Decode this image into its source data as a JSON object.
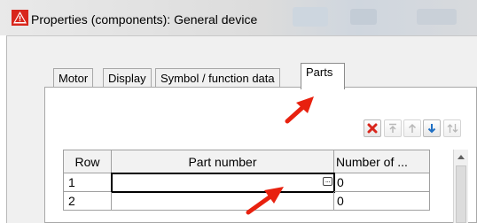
{
  "window": {
    "title": "Properties (components): General device"
  },
  "tabs": [
    {
      "label": "Motor",
      "active": false
    },
    {
      "label": "Display",
      "active": false
    },
    {
      "label": "Symbol / function data",
      "active": false
    },
    {
      "label": "Parts",
      "active": true
    }
  ],
  "toolbar": {
    "buttons": [
      {
        "name": "delete-row-button",
        "icon": "red-x-icon"
      },
      {
        "name": "move-to-top-button",
        "icon": "arrow-to-top-icon"
      },
      {
        "name": "move-up-button",
        "icon": "arrow-up-icon"
      },
      {
        "name": "move-down-button",
        "icon": "arrow-down-icon"
      },
      {
        "name": "sort-button",
        "icon": "up-down-arrows-icon"
      }
    ]
  },
  "table": {
    "columns": [
      "Row",
      "Part number",
      "Number of ..."
    ],
    "rows": [
      {
        "row": "1",
        "part_number": "",
        "count": "0"
      },
      {
        "row": "2",
        "part_number": "",
        "count": "0"
      }
    ]
  },
  "annotations": {
    "arrow_color": "#e8210f"
  }
}
